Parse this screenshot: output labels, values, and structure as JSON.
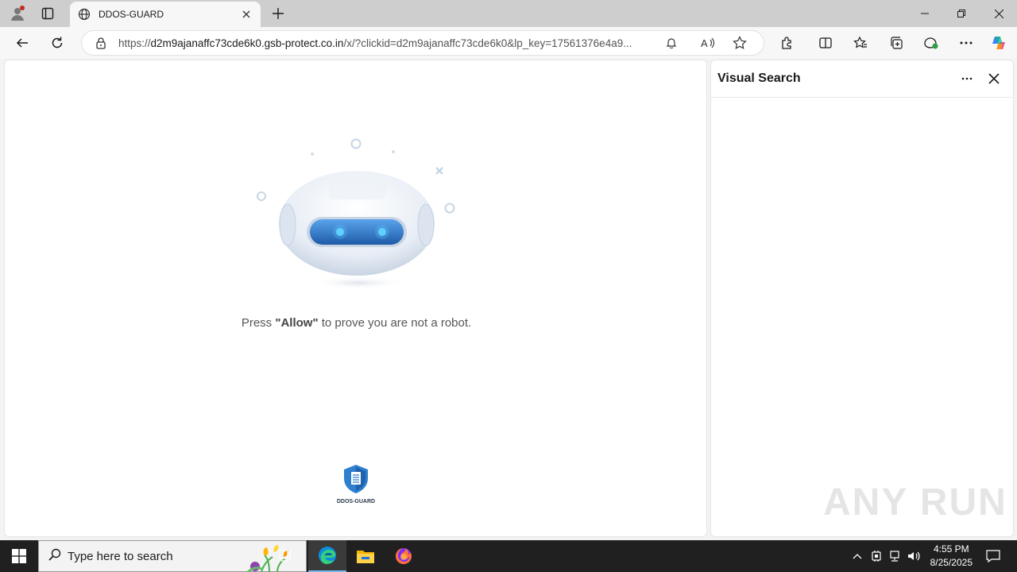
{
  "tab": {
    "title": "DDOS-GUARD"
  },
  "address": {
    "url_prefix": "https://",
    "url_host": "d2m9ajanaffc73cde6k0.gsb-protect.co.in",
    "url_rest": "/x/?clickid=d2m9ajanaffc73cde6k0&lp_key=17561376e4a9..."
  },
  "page": {
    "caption_pre": "Press ",
    "caption_bold": "\"Allow\"",
    "caption_post": " to prove you are not a robot.",
    "logo_text": "DDOS-GUARD"
  },
  "panel": {
    "title": "Visual Search"
  },
  "taskbar": {
    "search_placeholder": "Type here to search",
    "time": "4:55 PM",
    "date": "8/25/2025"
  },
  "watermark": "ANY RUN",
  "colors": {
    "accent_blue": "#2b6fc0",
    "panel_bg": "#ffffff",
    "taskbar": "#202020"
  }
}
